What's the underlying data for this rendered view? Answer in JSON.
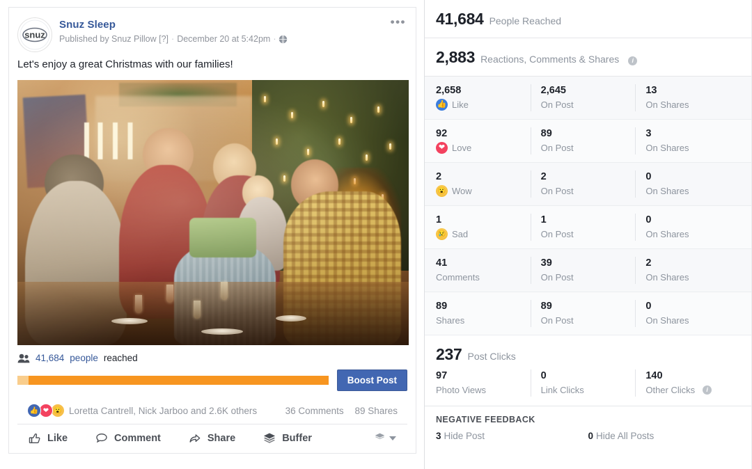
{
  "post": {
    "page_name": "Snuz Sleep",
    "avatar_text": "snuz",
    "published_by": "Published by Snuz Pillow [?]",
    "separator": "·",
    "timestamp": "December 20 at 5:42pm",
    "privacy_icon": "globe-icon",
    "more_menu": "•••",
    "message": "Let's enjoy a great Christmas with our families!",
    "photo_alt": "Family Christmas dinner by the fireplace with candlelit tree"
  },
  "reach": {
    "icon": "people-icon",
    "count": "41,684",
    "people_word": "people",
    "reached_word": "reached",
    "boost_label": "Boost Post",
    "bar_fill_percent": 96
  },
  "engagement": {
    "reactions_icons": [
      "like-icon",
      "love-icon",
      "wow-icon"
    ],
    "names": "Loretta Cantrell, Nick Jarboo and 2.6K others",
    "comments": "36 Comments",
    "shares": "89 Shares"
  },
  "actions": [
    {
      "label": "Like",
      "icon": "thumbs-up-icon"
    },
    {
      "label": "Comment",
      "icon": "comment-bubble-icon"
    },
    {
      "label": "Share",
      "icon": "share-arrow-icon"
    },
    {
      "label": "Buffer",
      "icon": "buffer-stack-icon"
    }
  ],
  "insights": {
    "people_reached": {
      "value": "41,684",
      "label": "People Reached"
    },
    "reactions_total": {
      "value": "2,883",
      "label": "Reactions, Comments & Shares",
      "info": "i"
    },
    "breakdown": [
      {
        "value": "2,658",
        "label": "Like",
        "icon": "like-icon",
        "on_post": "2,645",
        "on_post_label": "On Post",
        "on_shares": "13",
        "on_shares_label": "On Shares"
      },
      {
        "value": "92",
        "label": "Love",
        "icon": "love-icon",
        "on_post": "89",
        "on_post_label": "On Post",
        "on_shares": "3",
        "on_shares_label": "On Shares"
      },
      {
        "value": "2",
        "label": "Wow",
        "icon": "wow-icon",
        "on_post": "2",
        "on_post_label": "On Post",
        "on_shares": "0",
        "on_shares_label": "On Shares"
      },
      {
        "value": "1",
        "label": "Sad",
        "icon": "sad-icon",
        "on_post": "1",
        "on_post_label": "On Post",
        "on_shares": "0",
        "on_shares_label": "On Shares"
      },
      {
        "value": "41",
        "label": "Comments",
        "icon": "none",
        "on_post": "39",
        "on_post_label": "On Post",
        "on_shares": "2",
        "on_shares_label": "On Shares"
      },
      {
        "value": "89",
        "label": "Shares",
        "icon": "none",
        "on_post": "89",
        "on_post_label": "On Post",
        "on_shares": "0",
        "on_shares_label": "On Shares"
      }
    ],
    "post_clicks": {
      "value": "237",
      "label": "Post Clicks"
    },
    "clicks_breakdown": [
      {
        "value": "97",
        "label": "Photo Views"
      },
      {
        "value": "0",
        "label": "Link Clicks"
      },
      {
        "value": "140",
        "label": "Other Clicks",
        "info": "i"
      }
    ],
    "negative_feedback": {
      "title": "NEGATIVE FEEDBACK",
      "items": [
        {
          "value": "3",
          "label": "Hide Post"
        },
        {
          "value": "0",
          "label": "Hide All Posts"
        }
      ]
    }
  },
  "colors": {
    "facebook_blue": "#4267b2",
    "link_blue": "#365899",
    "reach_orange": "#f79520",
    "reach_orange_light": "#f9cd8c",
    "like_blue": "#3b7ddd",
    "love_red": "#f3425f",
    "wow_yellow": "#f0b429",
    "muted_text": "#8d949e"
  }
}
